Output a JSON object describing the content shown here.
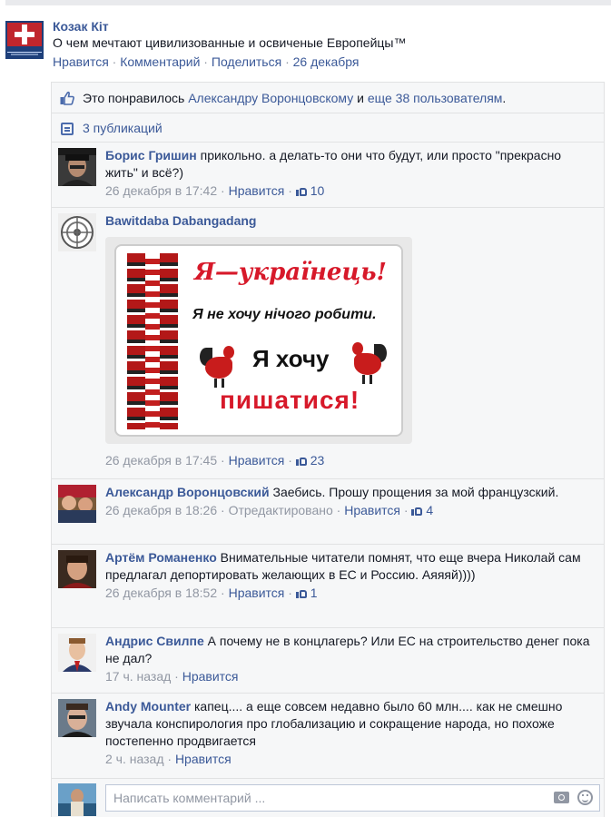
{
  "post": {
    "page_name": "Козак Кіт",
    "text": "О чем мечтают цивилизованные и освиченые Европейцы™",
    "actions": {
      "like": "Нравится",
      "comment": "Комментарий",
      "share": "Поделиться",
      "date": "26 декабря",
      "separator": " · "
    }
  },
  "ufi": {
    "likes": {
      "prefix": "Это понравилось ",
      "person": "Александру Воронцовскому",
      "middle": " и ",
      "others": "еще 38 пользователям",
      "suffix": "."
    },
    "shares": "3 публикаций"
  },
  "comments": [
    {
      "name": "Борис Гришин",
      "text": "прикольно. а делать-то они что будут, или просто \"прекрасно жить\" и всё?)",
      "time": "26 декабря в 17:42",
      "like": "Нравится",
      "likes": "10"
    },
    {
      "name": "Bawitdaba Dabangadang",
      "text": "",
      "time": "26 декабря в 17:45",
      "like": "Нравится",
      "likes": "23",
      "image": {
        "line1": "Я—українець!",
        "line2": "Я не хочу нічого робити.",
        "line3": "Я хочу",
        "line4": "пишатися!"
      }
    },
    {
      "name": "Александр Воронцовский",
      "text": "Заебись. Прошу прощения за мой французский.",
      "time": "26 декабря в 18:26",
      "edited": "Отредактировано",
      "like": "Нравится",
      "likes": "4"
    },
    {
      "name": "Артём Романенко",
      "text": "Внимательные читатели помнят, что еще вчера Николай сам предлагал депортировать желающих в ЕС и Россию. Аяяяй))))",
      "time": "26 декабря в 18:52",
      "like": "Нравится",
      "likes": "1"
    },
    {
      "name": "Андрис Свилпе",
      "text": "А почему не в концлагерь? Или ЕС на строительство денег пока не дал?",
      "time": "17 ч. назад",
      "like": "Нравится"
    },
    {
      "name": "Andy Mounter",
      "text": "капец.... а еще совсем недавно было 60 млн.... как не смешно звучала конспирология про глобализацию и сокращение народа, но похоже постепенно продвигается",
      "time": "2 ч. назад",
      "like": "Нравится"
    }
  ],
  "composer": {
    "placeholder": "Написать комментарий ..."
  },
  "icons": {
    "like": "thumbs-up-icon",
    "shares": "shares-icon",
    "camera": "camera-icon",
    "emoji": "smiley-icon"
  },
  "colors": {
    "link": "#3b5998",
    "meta": "#9197a3",
    "ufi_bg": "#f6f7f8"
  }
}
